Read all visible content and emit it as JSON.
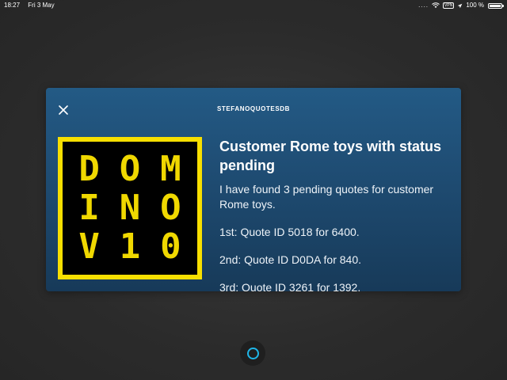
{
  "status_bar": {
    "time": "18:27",
    "date": "Fri 3 May",
    "signal_dots": "....",
    "vpn_label": "VPN",
    "battery_text": "100 %",
    "battery_level": 1.0,
    "icons": [
      "wifi-icon",
      "vpn-badge",
      "location-icon",
      "battery-icon"
    ]
  },
  "card": {
    "header": "STEFANOQUOTESDB",
    "close_icon": "close-icon",
    "title": "Customer Rome toys with status pending",
    "body": [
      "I have found 3 pending quotes for customer Rome toys.",
      "1st: Quote ID 5018 for 6400.",
      "2nd: Quote ID D0DA for 840.",
      "3rd: Quote ID 3261 for 1392."
    ],
    "logo": {
      "chars": [
        "D",
        "O",
        "M",
        "I",
        "N",
        "O",
        "V",
        "1",
        "0"
      ]
    }
  },
  "alexa_button": {
    "icon": "alexa-ring-icon"
  },
  "colors": {
    "card_top": "#235a85",
    "card_bottom": "#173a59",
    "logo_yellow": "#f7df00",
    "alexa_blue": "#1fb6e8",
    "background": "#2b2b2b"
  }
}
